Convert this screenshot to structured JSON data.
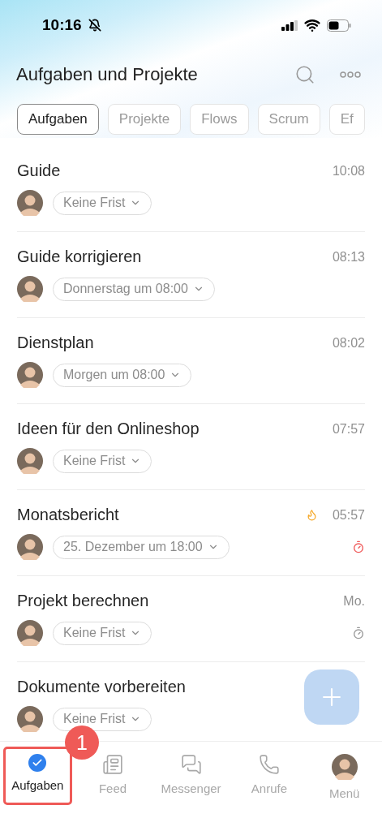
{
  "status_bar": {
    "time": "10:16"
  },
  "header": {
    "title": "Aufgaben und Projekte"
  },
  "tabs": [
    {
      "label": "Aufgaben",
      "selected": true
    },
    {
      "label": "Projekte",
      "selected": false
    },
    {
      "label": "Flows",
      "selected": false
    },
    {
      "label": "Scrum",
      "selected": false
    },
    {
      "label": "Ef",
      "selected": false
    }
  ],
  "tasks": [
    {
      "title": "Guide",
      "time": "10:08",
      "deadline": "Keine Frist",
      "hot": false
    },
    {
      "title": "Guide korrigieren",
      "time": "08:13",
      "deadline": "Donnerstag um 08:00",
      "hot": false
    },
    {
      "title": "Dienstplan",
      "time": "08:02",
      "deadline": "Morgen um 08:00",
      "hot": false
    },
    {
      "title": "Ideen für den Onlineshop",
      "time": "07:57",
      "deadline": "Keine Frist",
      "hot": false
    },
    {
      "title": "Monatsbericht",
      "time": "05:57",
      "deadline": "25. Dezember um 18:00",
      "hot": true,
      "timer_overdue": true
    },
    {
      "title": "Projekt berechnen",
      "time": "Mo.",
      "deadline": "Keine Frist",
      "hot": false,
      "timer_overdue": false
    },
    {
      "title": "Dokumente vorbereiten",
      "deadline": "Keine Frist",
      "hot": false
    }
  ],
  "nav": [
    {
      "label": "Aufgaben",
      "kind": "tasks",
      "selected": true,
      "highlighted": true
    },
    {
      "label": "Feed",
      "kind": "feed",
      "selected": false,
      "highlighted": false
    },
    {
      "label": "Messenger",
      "kind": "messenger",
      "selected": false,
      "highlighted": false
    },
    {
      "label": "Anrufe",
      "kind": "calls",
      "selected": false,
      "highlighted": false
    },
    {
      "label": "Menü",
      "kind": "menu",
      "selected": false,
      "highlighted": false
    }
  ],
  "annotation": {
    "label": "1"
  }
}
